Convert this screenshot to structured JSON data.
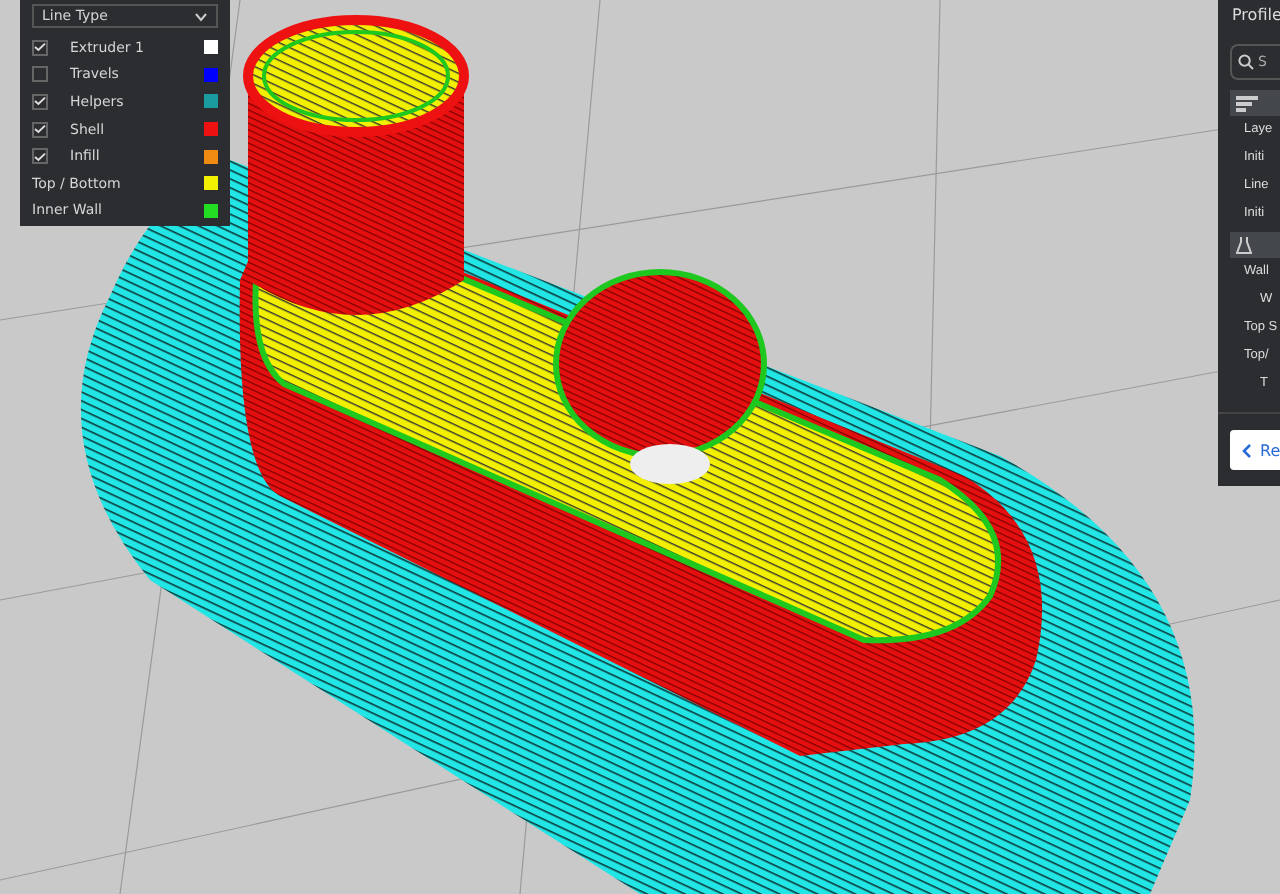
{
  "legend": {
    "dropdown": {
      "value": "Line Type"
    },
    "items": [
      {
        "kind": "checkbox",
        "label": "Extruder 1",
        "checked": true,
        "color": "#ffffff"
      },
      {
        "kind": "checkbox",
        "label": "Travels",
        "checked": false,
        "color": "#0000ff"
      },
      {
        "kind": "checkbox",
        "label": "Helpers",
        "checked": true,
        "color": "#1a9ba0"
      },
      {
        "kind": "checkbox",
        "label": "Shell",
        "checked": true,
        "color": "#ee1111"
      },
      {
        "kind": "checkbox",
        "label": "Infill",
        "checked": true,
        "color": "#f08a10"
      },
      {
        "kind": "plain",
        "label": "Top / Bottom",
        "color": "#f0f000"
      },
      {
        "kind": "plain",
        "label": "Inner Wall",
        "color": "#22dd22"
      }
    ]
  },
  "settings_panel": {
    "title": "Profile",
    "search": {
      "placeholder": "S"
    },
    "rows": [
      {
        "kind": "category"
      },
      {
        "kind": "setting",
        "label": "Laye"
      },
      {
        "kind": "setting",
        "label": "Initi"
      },
      {
        "kind": "setting",
        "label": "Line"
      },
      {
        "kind": "setting",
        "label": "Initi"
      },
      {
        "kind": "category"
      },
      {
        "kind": "setting",
        "label": "Wall"
      },
      {
        "kind": "subsetting",
        "label": "W"
      },
      {
        "kind": "setting",
        "label": "Top S"
      },
      {
        "kind": "setting",
        "label": "Top/"
      },
      {
        "kind": "subsetting",
        "label": "T"
      }
    ],
    "button": "Re"
  }
}
